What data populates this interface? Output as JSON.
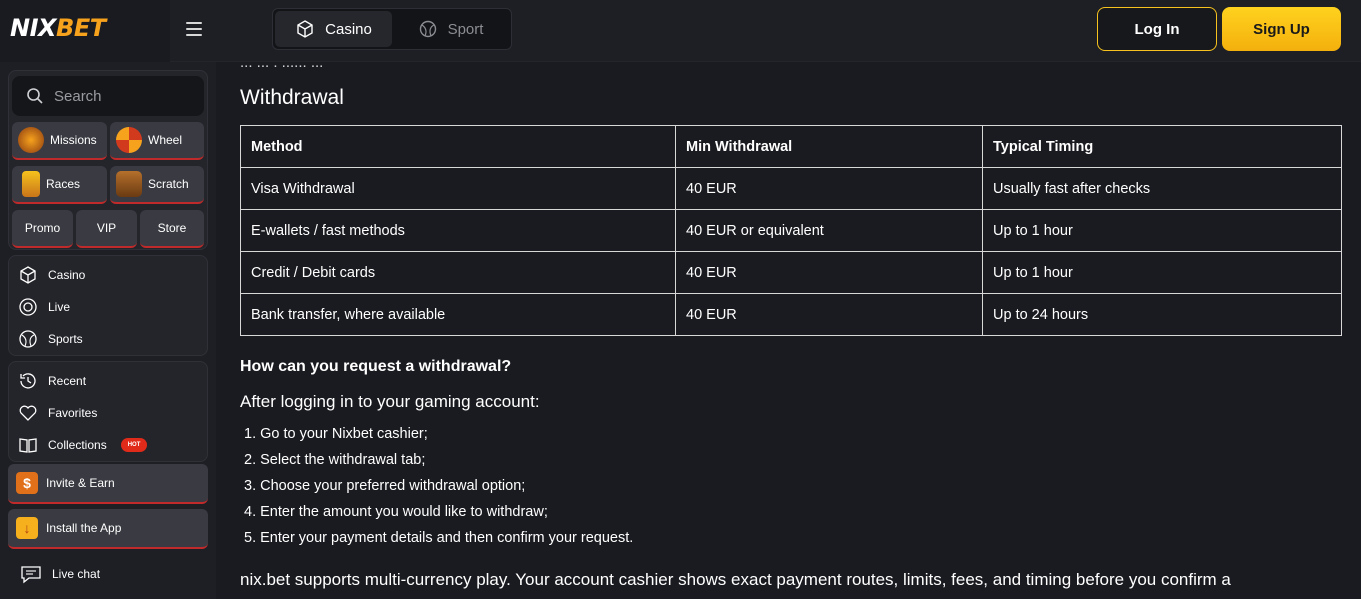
{
  "brand": {
    "logo_left": "NIX",
    "logo_right": "BET",
    "accent": "#f6a21d"
  },
  "header": {
    "tabs": [
      {
        "label": "Casino",
        "icon": "casino-icon",
        "active": true
      },
      {
        "label": "Sport",
        "icon": "sport-icon",
        "active": false
      }
    ],
    "login_label": "Log In",
    "signup_label": "Sign Up"
  },
  "sidebar": {
    "search_placeholder": "Search",
    "tiles": [
      {
        "label": "Missions",
        "icon": "missions-icon"
      },
      {
        "label": "Wheel",
        "icon": "wheel-icon"
      },
      {
        "label": "Races",
        "icon": "races-icon"
      },
      {
        "label": "Scratch",
        "icon": "scratch-icon"
      }
    ],
    "small_tiles": [
      "Promo",
      "VIP",
      "Store"
    ],
    "nav_main": [
      {
        "label": "Casino",
        "icon": "casino-icon"
      },
      {
        "label": "Live",
        "icon": "live-icon"
      },
      {
        "label": "Sports",
        "icon": "sports-icon"
      }
    ],
    "nav_user": [
      {
        "label": "Recent",
        "icon": "recent-icon"
      },
      {
        "label": "Favorites",
        "icon": "heart-icon"
      },
      {
        "label": "Collections",
        "icon": "book-icon",
        "badge": "HOT"
      }
    ],
    "invite_label": "Invite & Earn",
    "install_label": "Install the App",
    "livechat_label": "Live chat"
  },
  "main": {
    "cut_text": "... ... . ...... ...",
    "section_title": "Withdrawal",
    "table": {
      "headers": [
        "Method",
        "Min Withdrawal",
        "Typical Timing"
      ],
      "rows": [
        [
          "Visa Withdrawal",
          "40 EUR",
          "Usually fast after checks"
        ],
        [
          "E-wallets / fast methods",
          "40 EUR or equivalent",
          "Up to 1 hour"
        ],
        [
          "Credit / Debit cards",
          "40 EUR",
          "Up to 1 hour"
        ],
        [
          "Bank transfer, where available",
          "40 EUR",
          "Up to 24 hours"
        ]
      ]
    },
    "question": "How can you request a withdrawal?",
    "intro": "After logging in to your gaming account:",
    "steps": [
      "1. Go to your Nixbet cashier;",
      "2. Select the withdrawal tab;",
      "3. Choose your preferred withdrawal option;",
      "4. Enter the amount you would like to withdraw;",
      "5. Enter your payment details and then confirm your request."
    ],
    "footer_text": "nix.bet supports multi-currency play. Your account cashier shows exact payment routes, limits, fees, and timing before you confirm a"
  }
}
